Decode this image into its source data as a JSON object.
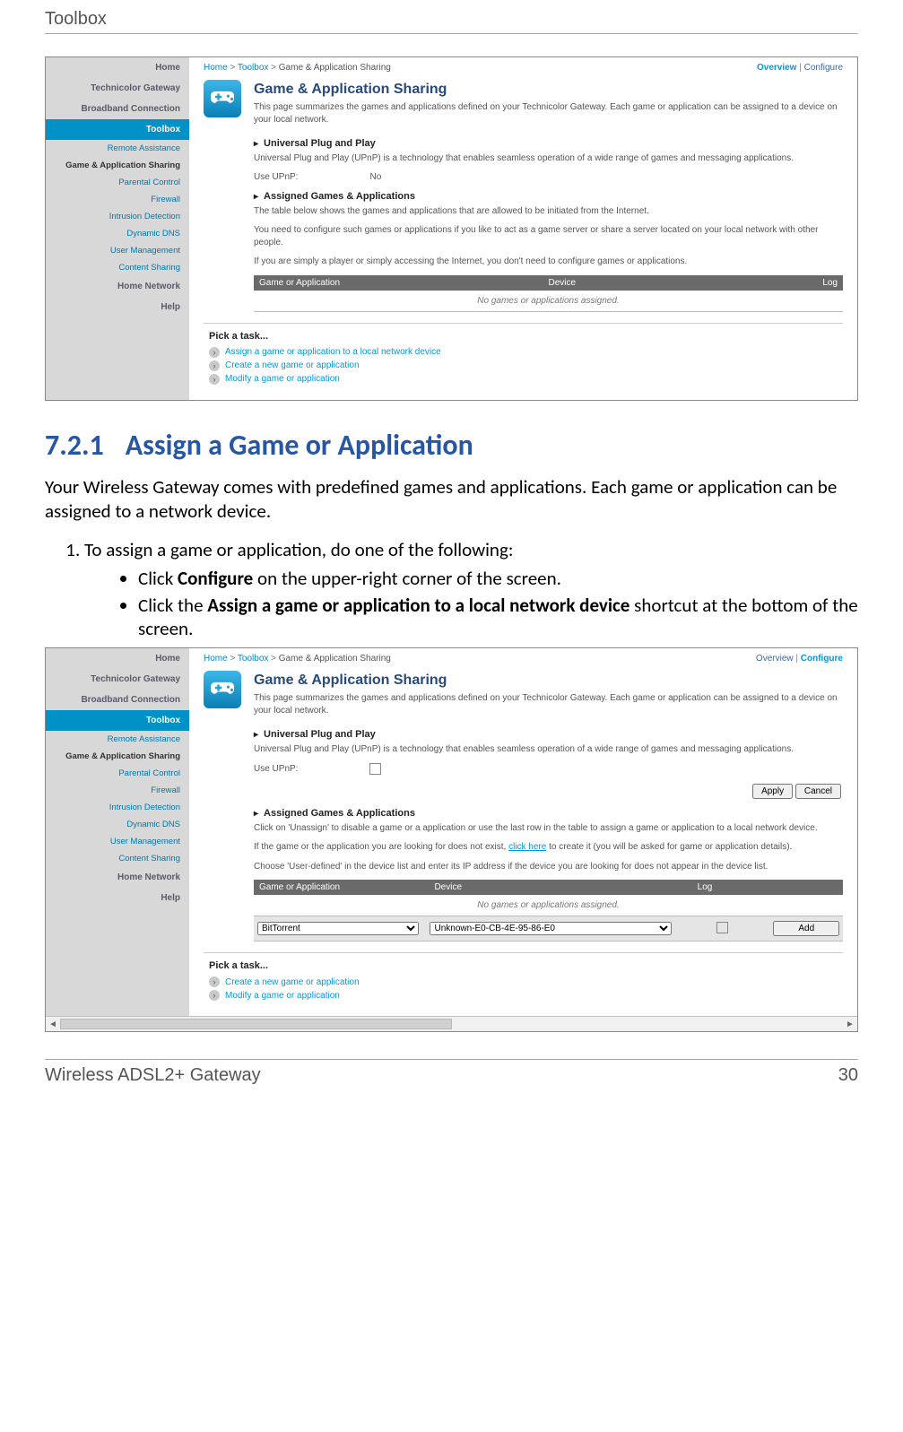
{
  "doc_header": "Toolbox",
  "doc_footer_left": "Wireless ADSL2+ Gateway",
  "doc_footer_right": "30",
  "heading_number": "7.2.1",
  "heading_text": "Assign a Game or Application",
  "intro_text": "Your Wireless Gateway comes with predefined games and applications. Each game or application can be assigned to a network device.",
  "step1_text": "To assign a game or application, do one of the following:",
  "bullet1_pre": "Click ",
  "bullet1_bold": "Configure",
  "bullet1_post": " on the upper-right corner of the screen.",
  "bullet2_pre": "Click the ",
  "bullet2_bold": "Assign a game or application to a local network device",
  "bullet2_post": " shortcut at the bottom of the screen.",
  "shared": {
    "breadcrumb1": "Home",
    "breadcrumb2": "Toolbox",
    "breadcrumb3": "Game & Application Sharing",
    "overview_label": "Overview",
    "configure_label": "Configure",
    "page_title": "Game & Application Sharing",
    "page_desc": "This page summarizes the games and applications defined on your Technicolor Gateway. Each game or application can be assigned to a device on your local network.",
    "upnp_h": "Universal Plug and Play",
    "upnp_desc": "Universal Plug and Play (UPnP) is a technology that enables seamless operation of a wide range of games and messaging applications.",
    "upnp_label": "Use UPnP:",
    "assigned_h": "Assigned Games & Applications",
    "th1": "Game or Application",
    "th2": "Device",
    "th3": "Log",
    "table_empty": "No games or applications assigned.",
    "pick_task": "Pick a task...",
    "task_assign": "Assign a game or application to a local network device",
    "task_create": "Create a new game or application",
    "task_modify": "Modify a game or application"
  },
  "sidebar_items": [
    {
      "label": "Home",
      "type": "primary"
    },
    {
      "label": "Technicolor Gateway",
      "type": "primary"
    },
    {
      "label": "Broadband Connection",
      "type": "primary"
    },
    {
      "label": "Toolbox",
      "type": "active"
    },
    {
      "label": "Remote Assistance",
      "type": "sub blue"
    },
    {
      "label": "Game & Application Sharing",
      "type": "sub bold"
    },
    {
      "label": "Parental Control",
      "type": "sub blue"
    },
    {
      "label": "Firewall",
      "type": "sub blue"
    },
    {
      "label": "Intrusion Detection",
      "type": "sub blue"
    },
    {
      "label": "Dynamic DNS",
      "type": "sub blue"
    },
    {
      "label": "User Management",
      "type": "sub blue"
    },
    {
      "label": "Content Sharing",
      "type": "sub blue"
    },
    {
      "label": "Home Network",
      "type": "primary"
    },
    {
      "label": "Help",
      "type": "primary"
    }
  ],
  "ss1": {
    "upnp_value": "No",
    "assigned_desc1": "The table below shows the games and applications that are allowed to be initiated from the Internet.",
    "assigned_desc2": "You need to configure such games or applications if you like to act as a game server or share a server located on your local network with other people.",
    "assigned_desc3": "If you are simply a player or simply accessing the Internet, you don't need to configure games or applications."
  },
  "ss2": {
    "assigned_desc1": "Click on 'Unassign' to disable a game or a application or use the last row in the table to assign a game or application to a local network device.",
    "assigned_desc2a": "If the game or the application you are looking for does not exist, ",
    "assigned_desc2_link": "click here",
    "assigned_desc2b": " to create it (you will be asked for game or application details).",
    "assigned_desc3": "Choose 'User-defined' in the device list and enter its IP address if the device you are looking for does not appear in the device list.",
    "apply_label": "Apply",
    "cancel_label": "Cancel",
    "add_label": "Add",
    "select_app": "BitTorrent",
    "select_device": "Unknown-E0-CB-4E-95-86-E0"
  }
}
